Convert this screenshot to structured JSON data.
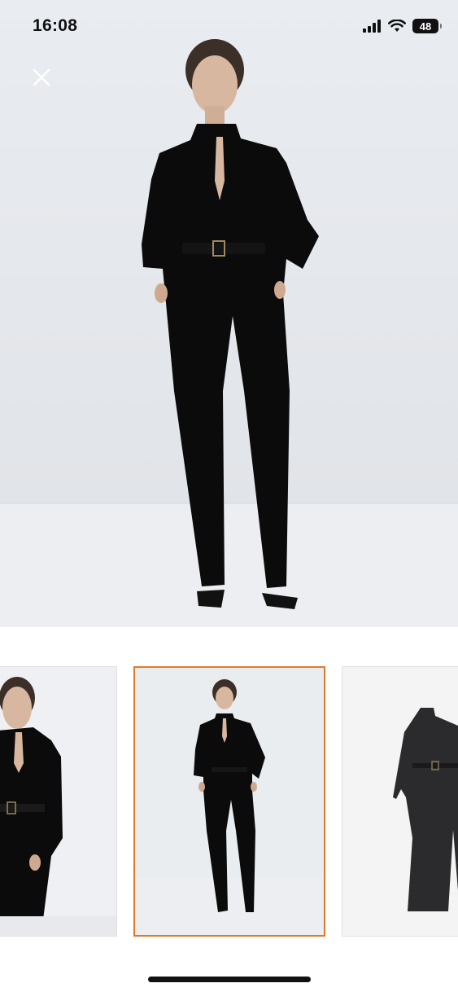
{
  "status_bar": {
    "time": "16:08",
    "battery_level": "48",
    "icons": [
      "cellular-signal-icon",
      "wifi-icon",
      "battery-icon"
    ]
  },
  "viewer": {
    "close_icon": "close-icon",
    "thumbnail_count": 3,
    "selected_thumbnail_index": 1,
    "selected_border_color": "#e07a2b"
  }
}
